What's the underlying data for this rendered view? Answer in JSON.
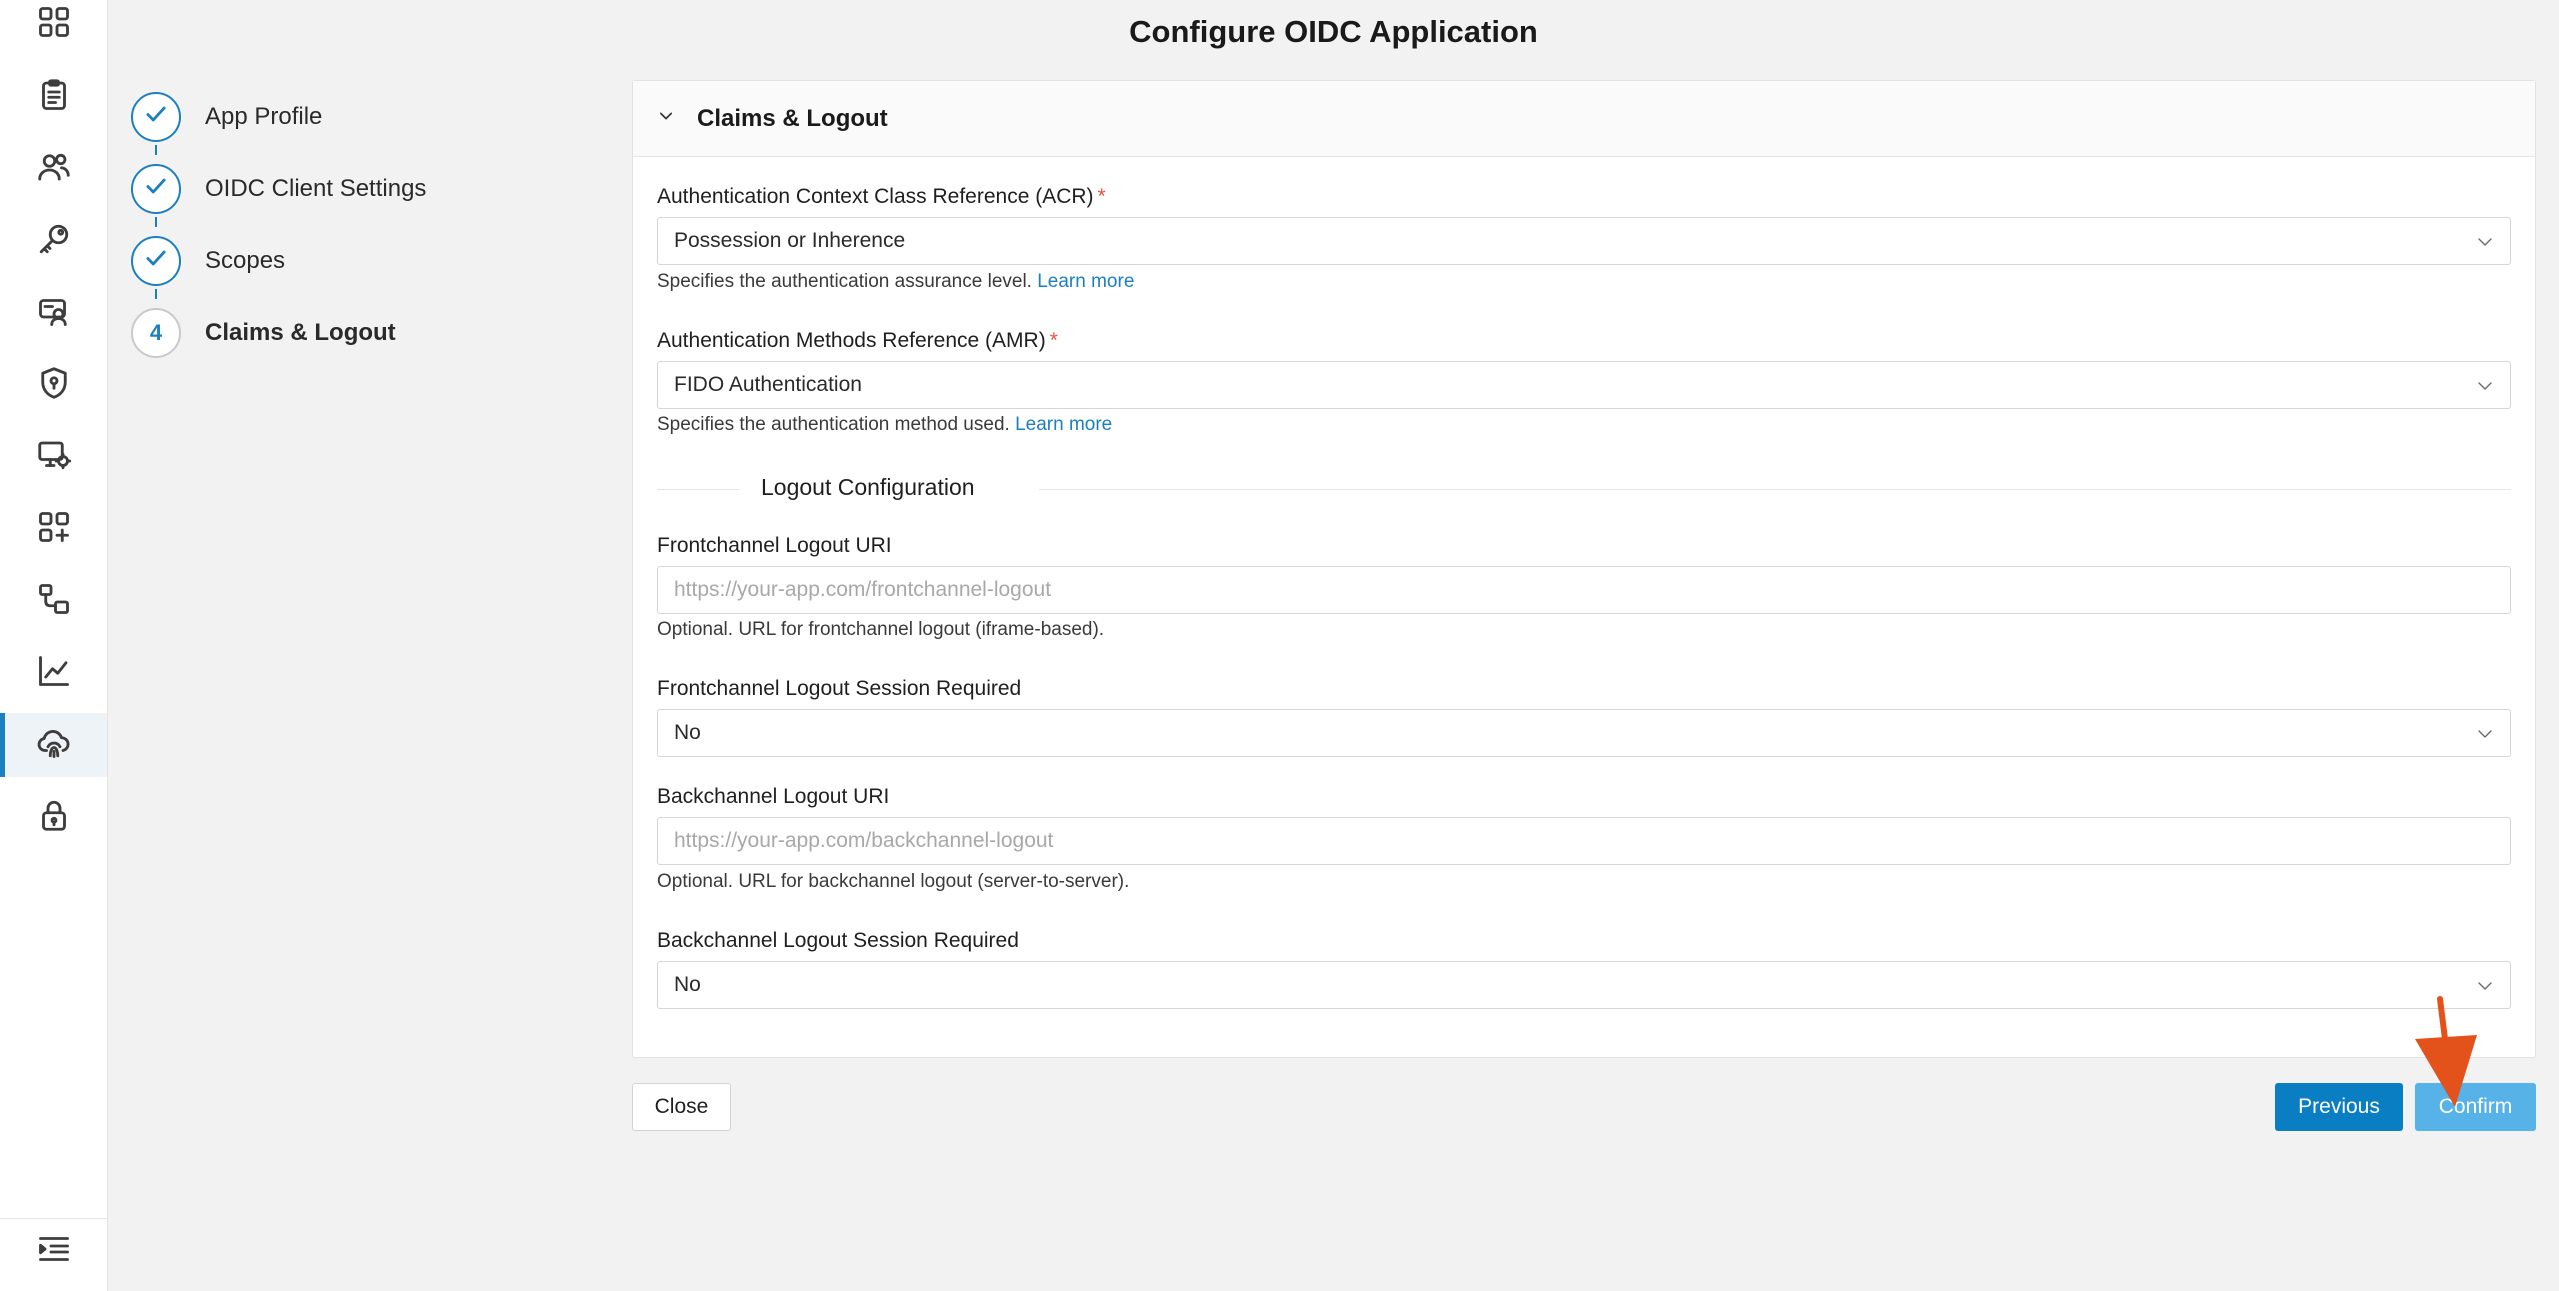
{
  "page": {
    "title": "Configure OIDC Application"
  },
  "rail": {
    "items": [
      {
        "icon": "dashboard-icon"
      },
      {
        "icon": "clipboard-icon"
      },
      {
        "icon": "users-icon"
      },
      {
        "icon": "key-icon"
      },
      {
        "icon": "identity-card-icon"
      },
      {
        "icon": "shield-icon"
      },
      {
        "icon": "monitor-settings-icon"
      },
      {
        "icon": "add-apps-icon"
      },
      {
        "icon": "workflow-icon"
      },
      {
        "icon": "analytics-chart-icon"
      },
      {
        "icon": "cloud-fingerprint-icon",
        "active": true
      },
      {
        "icon": "lock-icon"
      }
    ],
    "collapse_icon": "collapse-menu-icon"
  },
  "stepper": {
    "steps": [
      {
        "label": "App Profile",
        "status": "complete"
      },
      {
        "label": "OIDC Client Settings",
        "status": "complete"
      },
      {
        "label": "Scopes",
        "status": "complete"
      },
      {
        "label": "Claims & Logout",
        "status": "current",
        "number": "4"
      }
    ]
  },
  "panel": {
    "title": "Claims & Logout",
    "acr": {
      "label": "Authentication Context Class Reference (ACR)",
      "required_mark": "*",
      "value": "Possession or Inherence",
      "help": "Specifies the authentication assurance level.",
      "help_link": "Learn more"
    },
    "amr": {
      "label": "Authentication Methods Reference (AMR)",
      "required_mark": "*",
      "value": "FIDO Authentication",
      "help": "Specifies the authentication method used.",
      "help_link": "Learn more"
    },
    "logout_section_title": "Logout Configuration",
    "frontchannel_uri": {
      "label": "Frontchannel Logout URI",
      "value": "",
      "placeholder": "https://your-app.com/frontchannel-logout",
      "help": "Optional. URL for frontchannel logout (iframe-based)."
    },
    "frontchannel_session": {
      "label": "Frontchannel Logout Session Required",
      "value": "No"
    },
    "backchannel_uri": {
      "label": "Backchannel Logout URI",
      "value": "",
      "placeholder": "https://your-app.com/backchannel-logout",
      "help": "Optional. URL for backchannel logout (server-to-server)."
    },
    "backchannel_session": {
      "label": "Backchannel Logout Session Required",
      "value": "No"
    }
  },
  "footer": {
    "close_label": "Close",
    "previous_label": "Previous",
    "confirm_label": "Confirm"
  },
  "colors": {
    "accent": "#1b7fc0",
    "primary_button": "#0a7ec2",
    "confirm_button": "#56b2e7",
    "required": "#e8553b",
    "annotation_arrow": "#e4521b"
  }
}
